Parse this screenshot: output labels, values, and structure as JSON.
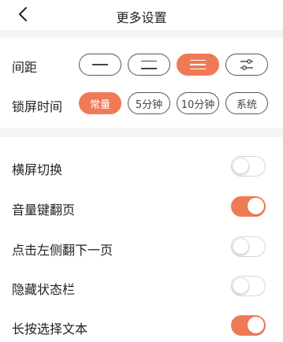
{
  "header": {
    "title": "更多设置",
    "back_icon": "chevron-left-icon"
  },
  "spacing": {
    "label": "间距",
    "options": [
      {
        "icon": "spacing-single-line-icon",
        "lines": 1,
        "active": false
      },
      {
        "icon": "spacing-double-line-icon",
        "lines": 2,
        "active": false
      },
      {
        "icon": "spacing-triple-line-icon",
        "lines": 3,
        "active": true
      },
      {
        "icon": "spacing-custom-sliders-icon",
        "lines": 0,
        "active": false
      }
    ]
  },
  "screen_lock": {
    "label": "锁屏时间",
    "options": [
      {
        "label": "常量",
        "active": true
      },
      {
        "label": "5分钟",
        "active": false
      },
      {
        "label": "10分钟",
        "active": false
      },
      {
        "label": "系统",
        "active": false
      }
    ]
  },
  "toggles": [
    {
      "label": "横屏切换",
      "on": false
    },
    {
      "label": "音量键翻页",
      "on": true
    },
    {
      "label": "点击左侧翻下一页",
      "on": false
    },
    {
      "label": "隐藏状态栏",
      "on": false
    },
    {
      "label": "长按选择文本",
      "on": true
    }
  ],
  "colors": {
    "accent": "#f07a55",
    "band": "#f4f4f4",
    "text": "#222222"
  }
}
